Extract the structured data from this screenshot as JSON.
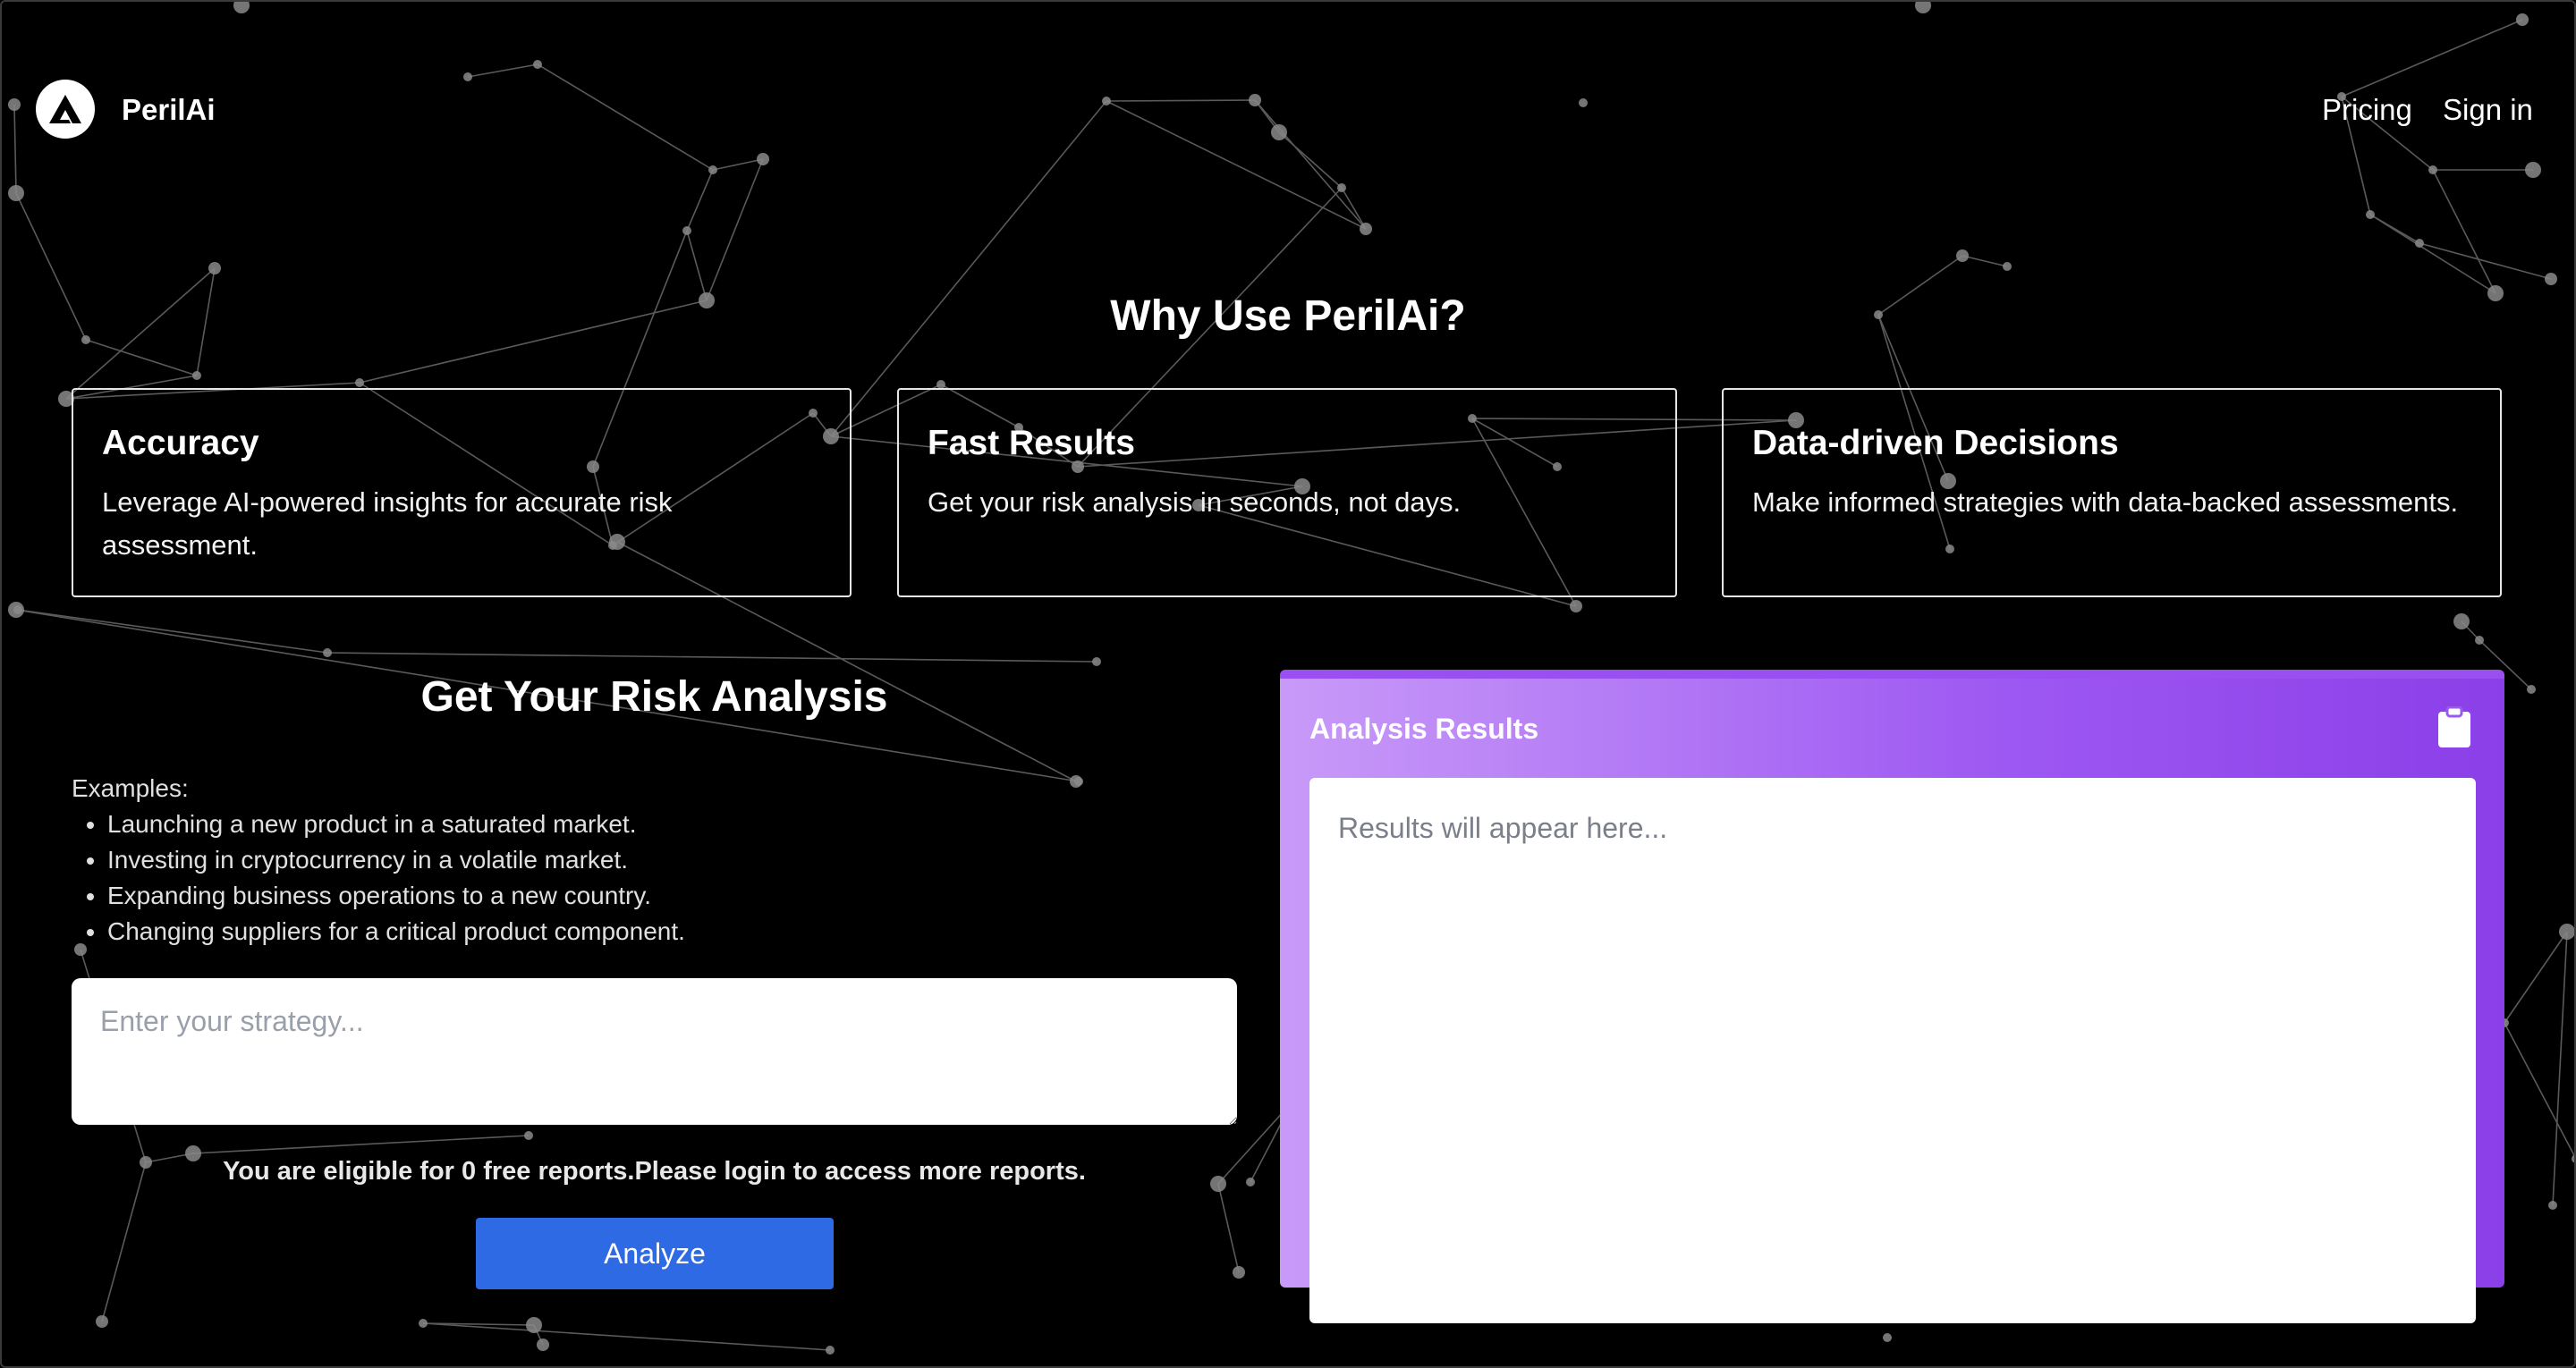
{
  "header": {
    "brand": "PerilAi",
    "logo_icon": "triangle-logo-icon",
    "nav": {
      "pricing": "Pricing",
      "signin": "Sign in"
    }
  },
  "why": {
    "title": "Why Use PerilAi?",
    "cards": [
      {
        "title": "Accuracy",
        "description": "Leverage AI-powered insights for accurate risk assessment."
      },
      {
        "title": "Fast Results",
        "description": "Get your risk analysis in seconds, not days."
      },
      {
        "title": "Data-driven Decisions",
        "description": "Make informed strategies with data-backed assessments."
      }
    ]
  },
  "form": {
    "title": "Get Your Risk Analysis",
    "examples_label": "Examples:",
    "examples": [
      "Launching a new product in a saturated market.",
      "Investing in cryptocurrency in a volatile market.",
      "Expanding business operations to a new country.",
      "Changing suppliers for a critical product component."
    ],
    "input_placeholder": "Enter your strategy...",
    "input_value": "",
    "eligibility": "You are eligible for 0 free reports.Please login to access more reports.",
    "analyze_label": "Analyze"
  },
  "results": {
    "title": "Analysis Results",
    "copy_icon": "clipboard-icon",
    "placeholder": "Results will appear here..."
  },
  "colors": {
    "background": "#000000",
    "accent_button": "#2d6ae3",
    "results_gradient_start": "#c89af8",
    "results_gradient_end": "#8b3fe8"
  }
}
